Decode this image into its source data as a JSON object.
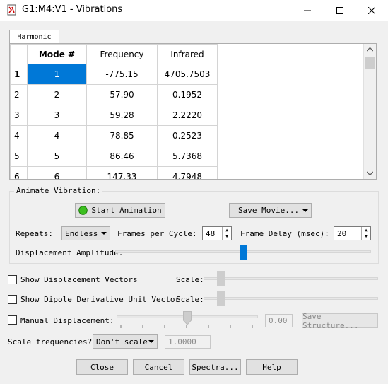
{
  "window": {
    "title": "G1:M4:V1 - Vibrations"
  },
  "tab": {
    "label": "Harmonic"
  },
  "grid": {
    "columns": [
      "Mode #",
      "Frequency",
      "Infrared"
    ],
    "rows": [
      {
        "row": "1",
        "mode": "1",
        "freq": "-775.15",
        "ir": "4705.7503"
      },
      {
        "row": "2",
        "mode": "2",
        "freq": "57.90",
        "ir": "0.1952"
      },
      {
        "row": "3",
        "mode": "3",
        "freq": "59.28",
        "ir": "2.2220"
      },
      {
        "row": "4",
        "mode": "4",
        "freq": "78.85",
        "ir": "0.2523"
      },
      {
        "row": "5",
        "mode": "5",
        "freq": "86.46",
        "ir": "5.7368"
      },
      {
        "row": "6",
        "mode": "6",
        "freq": "147.33",
        "ir": "4.7948"
      }
    ]
  },
  "animate": {
    "group_label": "Animate Vibration:",
    "start_label": "Start Animation",
    "save_movie_label": "Save Movie...",
    "repeats_label": "Repeats:",
    "repeats_value": "Endless",
    "fpc_label": "Frames per Cycle:",
    "fpc_value": "48",
    "delay_label": "Frame Delay (msec):",
    "delay_value": "20",
    "amplitude_label": "Displacement Amplitude:",
    "amplitude_level": 0.5
  },
  "options": {
    "show_disp_label": "Show Displacement Vectors",
    "show_dipole_label": "Show Dipole Derivative Unit Vector",
    "scale_label": "Scale:",
    "manual_label": "Manual Displacement:",
    "manual_value": "0.00",
    "save_structure_label": "Save Structure...",
    "scale_freq_label": "Scale frequencies?",
    "scale_freq_value": "Don't scale",
    "scale_factor": "1.0000"
  },
  "buttons": {
    "close": "Close",
    "cancel": "Cancel",
    "spectra": "Spectra...",
    "help": "Help"
  },
  "colors": {
    "selection": "#0078d7",
    "start_icon": "#3cbf1f"
  }
}
